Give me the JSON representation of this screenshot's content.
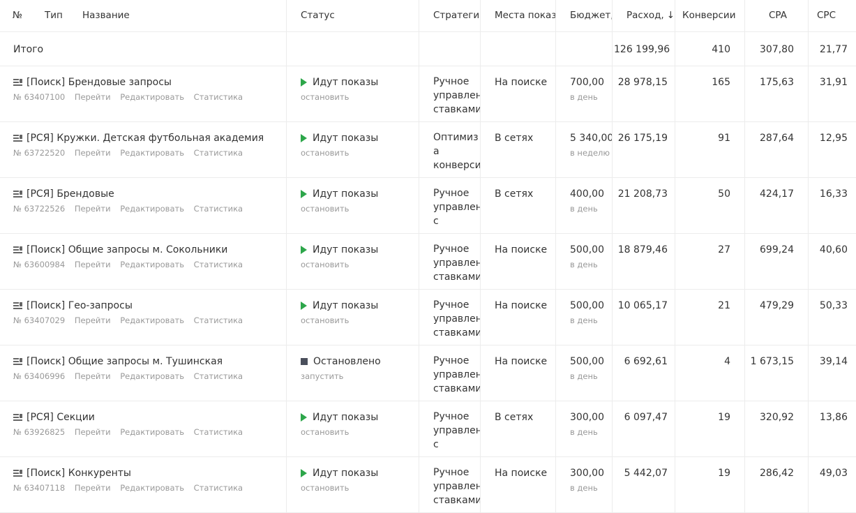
{
  "header": {
    "num": "№",
    "type": "Тип",
    "name": "Название",
    "status": "Статус",
    "strategy": "Стратегия",
    "places": "Места показов",
    "budget": "Бюджет,",
    "spend": "Расход,",
    "sort_icon": "arrow-down-icon",
    "conversions": "Конверсии",
    "cpa": "CPA",
    "cpc": "CPC"
  },
  "total": {
    "label": "Итого",
    "spend": "126 199,96",
    "conversions": "410",
    "cpa": "307,80",
    "cpc": "21,77"
  },
  "actions": {
    "go": "Перейти",
    "edit": "Редактировать",
    "stats": "Статистика"
  },
  "campaigns": [
    {
      "name": "[Поиск] Брендовые запросы",
      "id": "№ 63407100",
      "status": "Идут показы",
      "status_action": "остановить",
      "strategy": "Ручное управление ставками",
      "places": "На поиске",
      "budget": "700,00",
      "budget_period": "в день",
      "spend": "28 978,15",
      "conversions": "165",
      "cpa": "175,63",
      "cpc": "31,91"
    },
    {
      "name": "[РСЯ] Кружки. Детская футбольная академия",
      "id": "№ 63722520",
      "status": "Идут показы",
      "status_action": "остановить",
      "strategy": "Оптимизация конверсий",
      "places": "В сетях",
      "budget": "5 340,00",
      "budget_period": "в неделю",
      "spend": "26 175,19",
      "conversions": "91",
      "cpa": "287,64",
      "cpc": "12,95"
    },
    {
      "name": "[РСЯ] Брендовые",
      "id": "№ 63722526",
      "status": "Идут показы",
      "status_action": "остановить",
      "strategy": "Ручное управление с",
      "places": "В сетях",
      "budget": "400,00",
      "budget_period": "в день",
      "spend": "21 208,73",
      "conversions": "50",
      "cpa": "424,17",
      "cpc": "16,33"
    },
    {
      "name": "[Поиск] Общие запросы м. Сокольники",
      "id": "№ 63600984",
      "status": "Идут показы",
      "status_action": "остановить",
      "strategy": "Ручное управление ставками",
      "places": "На поиске",
      "budget": "500,00",
      "budget_period": "в день",
      "spend": "18 879,46",
      "conversions": "27",
      "cpa": "699,24",
      "cpc": "40,60"
    },
    {
      "name": "[Поиск] Гео-запросы",
      "id": "№ 63407029",
      "status": "Идут показы",
      "status_action": "остановить",
      "strategy": "Ручное управление ставками",
      "places": "На поиске",
      "budget": "500,00",
      "budget_period": "в день",
      "spend": "10 065,17",
      "conversions": "21",
      "cpa": "479,29",
      "cpc": "50,33"
    },
    {
      "name": "[Поиск] Общие запросы м. Тушинская",
      "id": "№ 63406996",
      "status": "Остановлено",
      "status_action": "запустить",
      "strategy": "Ручное управление ставками",
      "places": "На поиске",
      "budget": "500,00",
      "budget_period": "в день",
      "spend": "6 692,61",
      "conversions": "4",
      "cpa": "1 673,15",
      "cpc": "39,14"
    },
    {
      "name": "[РСЯ] Секции",
      "id": "№ 63926825",
      "status": "Идут показы",
      "status_action": "остановить",
      "strategy": "Ручное управление с",
      "places": "В сетях",
      "budget": "300,00",
      "budget_period": "в день",
      "spend": "6 097,47",
      "conversions": "19",
      "cpa": "320,92",
      "cpc": "13,86"
    },
    {
      "name": "[Поиск] Конкуренты",
      "id": "№ 63407118",
      "status": "Идут показы",
      "status_action": "остановить",
      "strategy": "Ручное управление ставками",
      "places": "На поиске",
      "budget": "300,00",
      "budget_period": "в день",
      "spend": "5 442,07",
      "conversions": "19",
      "cpa": "286,42",
      "cpc": "49,03"
    }
  ],
  "strategy_lines": [
    [
      "Ручное",
      "управлен",
      "ставками"
    ],
    [
      "Оптимиза",
      "конверси"
    ],
    [
      "Ручное",
      "управлен",
      "с"
    ],
    [
      "Ручное",
      "управлен",
      "ставками"
    ],
    [
      "Ручное",
      "управлен",
      "ставками"
    ],
    [
      "Ручное",
      "управлен",
      "ставками"
    ],
    [
      "Ручное",
      "управлен",
      "с"
    ],
    [
      "Ручное",
      "управлен",
      "ставками"
    ]
  ],
  "colors": {
    "running": "#2da64a",
    "stopped": "#4a4f5c",
    "muted": "#999999",
    "border": "#ececec"
  }
}
